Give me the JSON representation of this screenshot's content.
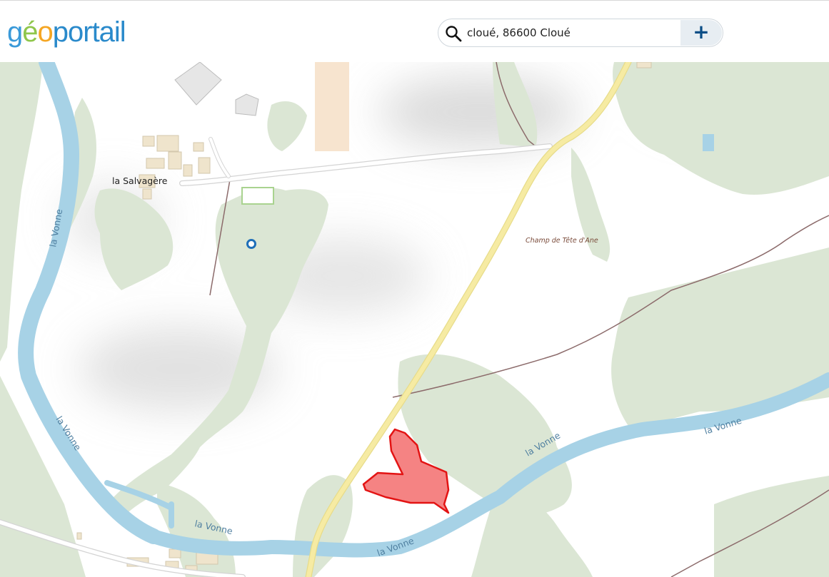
{
  "logo": {
    "part1": "g",
    "part2": "é",
    "part3": "o",
    "part4": "portail"
  },
  "search": {
    "value": "cloué, 86600 Cloué",
    "add_label": "+"
  },
  "map": {
    "labels": {
      "hamlet": "la Salvagère",
      "lieu_dit": "Champ de Tête d'Ane",
      "river_1": "la Vonne",
      "river_2": "la Vonne",
      "river_3": "la Vonne",
      "river_4": "la Vonne",
      "river_5": "la Vonne",
      "river_6": "la Vonne"
    },
    "colors": {
      "water": "#a7d2e6",
      "forest": "#dbe6d4",
      "road": "#f6eba3",
      "building": "#efe4cc",
      "parcel": "#f47c7c",
      "parcel_stroke": "#e31414",
      "marker": "#1f6fb8",
      "path": "#8c6b6b"
    }
  }
}
